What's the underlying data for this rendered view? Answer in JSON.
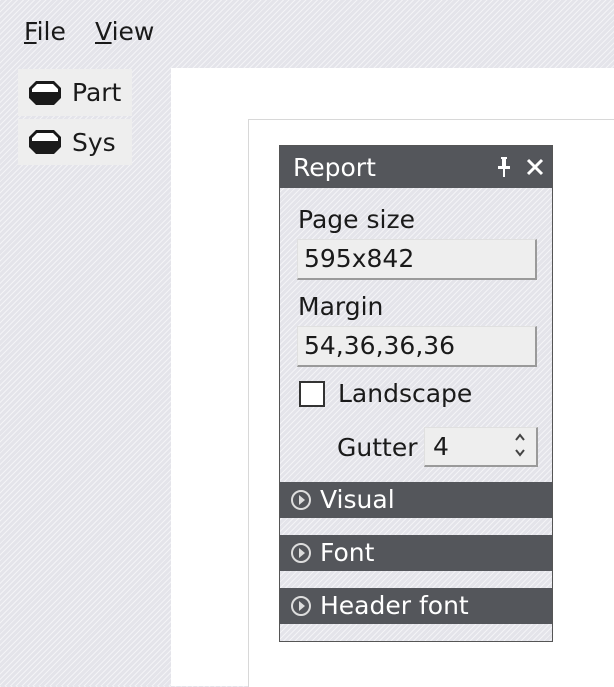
{
  "menu": {
    "file": {
      "accel": "F",
      "rest": "ile"
    },
    "view": {
      "accel": "V",
      "rest": "iew"
    }
  },
  "sidebar": {
    "items": [
      {
        "label": "Part",
        "icon": "hexagon-icon"
      },
      {
        "label": "Sys",
        "icon": "hexagon-icon"
      }
    ]
  },
  "report": {
    "title": "Report",
    "page_size_label": "Page size",
    "page_size_value": "595x842",
    "margin_label": "Margin",
    "margin_value": "54,36,36,36",
    "landscape_label": "Landscape",
    "landscape_checked": false,
    "gutter_label": "Gutter",
    "gutter_value": "4",
    "sections": [
      {
        "label": "Visual",
        "expanded": false
      },
      {
        "label": "Font",
        "expanded": false
      },
      {
        "label": "Header font",
        "expanded": false
      }
    ]
  },
  "colors": {
    "panel_header": "#54565b",
    "background": "#e4e4ea",
    "field": "#eeeeee"
  }
}
